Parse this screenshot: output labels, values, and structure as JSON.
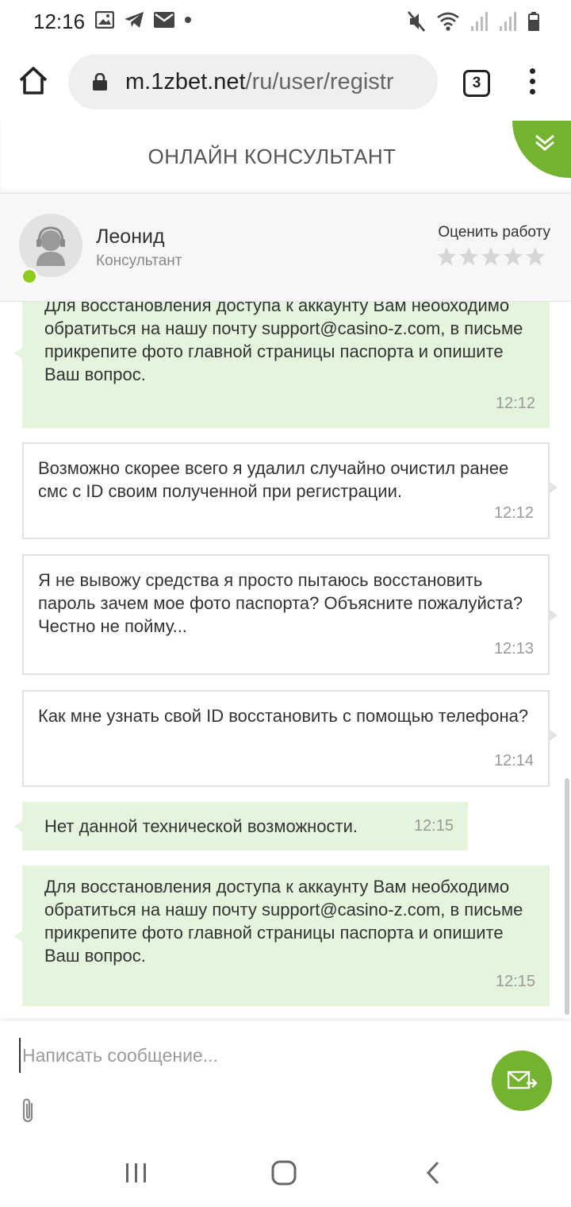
{
  "status_bar": {
    "time": "12:16",
    "left_icons": [
      "image-icon",
      "telegram-icon",
      "mail-icon",
      "dot-icon"
    ],
    "right_icons": [
      "mute-icon",
      "wifi-icon",
      "signal-icon",
      "signal-icon",
      "battery-icon"
    ]
  },
  "browser": {
    "url_host": "m.1zbet.net",
    "url_path": "/ru/user/registr",
    "tab_count": "3"
  },
  "chat": {
    "title": "ОНЛАЙН КОНСУЛЬТАНТ",
    "accent_color": "#74b330",
    "consultant": {
      "name": "Леонид",
      "role": "Консультант",
      "rate_label": "Оценить работу",
      "rating_stars": 5,
      "rating_value": 0,
      "online": true
    },
    "messages": [
      {
        "from": "operator",
        "text": "Для восстановления доступа к аккаунту Вам необходимо обратиться на нашу почту support@casino-z.com, в письме прикрепите фото главной страницы паспорта и опишите Ваш вопрос.",
        "time": "12:12"
      },
      {
        "from": "user",
        "text": "Возможно скорее всего я удалил случайно очистил ранее смс с ID своим полученной при регистрации.",
        "time": "12:12"
      },
      {
        "from": "user",
        "text": "Я не вывожу средства я просто пытаюсь восстановить пароль зачем мое фото паспорта? Объясните пожалуйста? Честно не пойму...",
        "time": "12:13"
      },
      {
        "from": "user",
        "text": "Как мне узнать свой ID восстановить с помощью телефона?",
        "time": "12:14"
      },
      {
        "from": "operator",
        "text": "Нет данной технической возможности.",
        "time": "12:15"
      },
      {
        "from": "operator",
        "text": "Для восстановления доступа к аккаунту Вам необходимо обратиться на нашу почту support@casino-z.com, в письме прикрепите фото главной страницы паспорта и опишите Ваш вопрос.",
        "time": "12:15"
      }
    ],
    "composer": {
      "placeholder": "Написать сообщение...",
      "value": ""
    }
  },
  "nav_bar": {
    "buttons": [
      "recents-icon",
      "home-icon",
      "back-icon"
    ]
  }
}
